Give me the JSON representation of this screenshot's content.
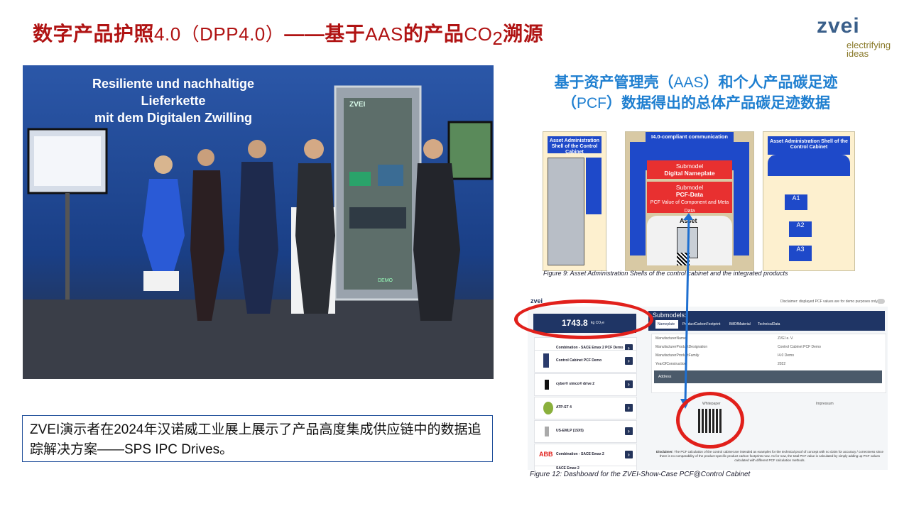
{
  "slide": {
    "title_part1": "数字产品护照",
    "title_part2": "4.0（DPP4.0）",
    "title_part3": "——基于",
    "title_part4": "AAS",
    "title_part5": "的产品",
    "title_part6": "CO",
    "title_sub": "2",
    "title_part7": "溯源"
  },
  "logo": {
    "name": "zvei",
    "tagline_1": "electrifying",
    "tagline_2": "ideas"
  },
  "photo": {
    "banner_line1": "Resiliente und nachhaltige Lieferkette",
    "banner_line2": "mit dem Digitalen Zwilling",
    "cabinet_label": "ZVEI",
    "panel_label": "DEMO"
  },
  "caption": {
    "text": "ZVEI演示者在2024年汉诺威工业展上展示了产品高度集成供应链中的数据追踪解决方案——SPS IPC Drives。"
  },
  "right_heading": {
    "line1a": "基于资产管理壳（",
    "line1b": "AAS",
    "line1c": "）和个人产品碳足迹",
    "line2a": "（",
    "line2b": "PCF",
    "line2c": "）数据得出的总体产品碳足迹数据"
  },
  "figure9": {
    "left_title": "Asset Administration Shell of the Control Cabinet",
    "comm_label": "I4.0-compliant communication",
    "submodel1_line1": "Submodel",
    "submodel1_line2": "Digital Nameplate",
    "submodel2_line1": "Submodel",
    "submodel2_line2": "PCF-Data",
    "submodel2_line3": "PCF Value of Component and Meta Data",
    "asset_label": "Asset",
    "right_title": "Asset Administration Shell of the Control Cabinet",
    "a1": "A1",
    "a2": "A2",
    "a3": "A3",
    "caption": "Figure 9: Asset Administration Shells of the control cabinet and the integrated products"
  },
  "dashboard": {
    "brand": "zvei",
    "disclaimer_top": "Disclaimer: displayed PCF values are for demo purposes only",
    "pcf_value": "1743.8",
    "pcf_unit": "kg CO₂e",
    "submodels_title": "Submodels:",
    "tabs": [
      "Nameplate",
      "ProductCarbonFootprint",
      "BillOfMaterial",
      "TechnicalData"
    ],
    "products": [
      "Combination - SACE Emax 2 PCF Demo",
      "Control Cabinet PCF Demo",
      "cyber® simco® drive 2",
      "ATP-ST 4",
      "US-EMLP (15X5)",
      "Combination - SACE Emax 2",
      "SACE Emax 2"
    ],
    "fields": [
      {
        "key": "ManufacturerName",
        "value": "ZVEI e. V."
      },
      {
        "key": "ManufacturerProductDesignation",
        "value": "Control Cabinet PCF Demo"
      },
      {
        "key": "ManufacturerProductFamily",
        "value": "I4.0 Demo"
      },
      {
        "key": "YearOfConstruction",
        "value": "2022"
      }
    ],
    "address_label": "Address",
    "whitepaper": "Whitepaper",
    "impressum": "Impressum",
    "disclaimer_bottom_label": "Disclaimer:",
    "disclaimer_bottom": "The PCF calculation of the control cabinet are intended as examples for the technical proof of concept with no claim for accuracy / correctness since there is no comparability of the product-specific product carbon footprints now. As for now, the total PCF value is calculated by simply adding up PCF values calculated with different PCF calculation methods.",
    "caption": "Figure 12: Dashboard for the ZVEI-Show-Case PCF@Control Cabinet"
  },
  "colors": {
    "title_red": "#b01313",
    "heading_blue": "#1f7fd0",
    "ring_red": "#e1201b",
    "aas_blue": "#1e49c9",
    "dash_navy": "#1f3565"
  }
}
